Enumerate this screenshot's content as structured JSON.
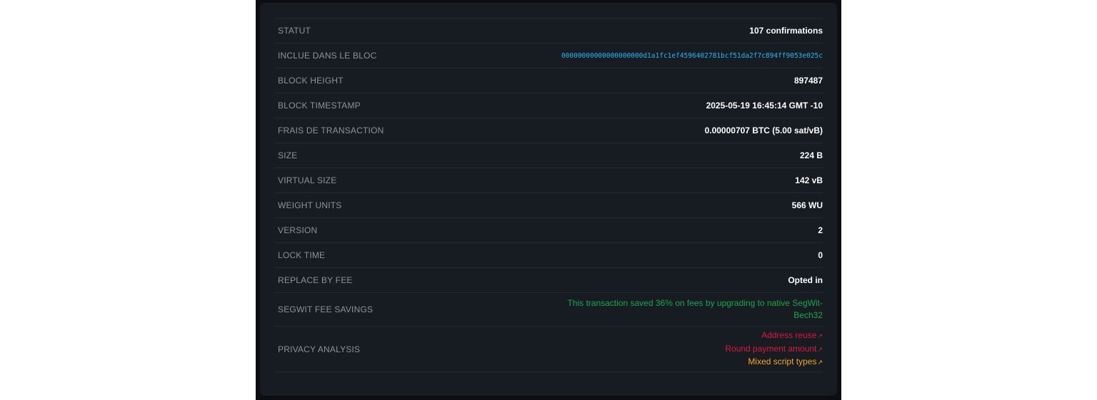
{
  "rows": [
    {
      "label": "STATUT",
      "value": "107 confirmations"
    },
    {
      "label": "INCLUE DANS LE BLOC",
      "value": "00000000000000000000d1a1fc1ef4596402781bcf51da2f7c894ff9053e025c"
    },
    {
      "label": "BLOCK HEIGHT",
      "value": "897487"
    },
    {
      "label": "BLOCK TIMESTAMP",
      "value": "2025-05-19 16:45:14 GMT -10"
    },
    {
      "label": "FRAIS DE TRANSACTION",
      "value": "0.00000707 BTC (5.00 sat/vB)"
    },
    {
      "label": "SIZE",
      "value": "224 B"
    },
    {
      "label": "VIRTUAL SIZE",
      "value": "142 vB"
    },
    {
      "label": "WEIGHT UNITS",
      "value": "566 WU"
    },
    {
      "label": "VERSION",
      "value": "2"
    },
    {
      "label": "LOCK TIME",
      "value": "0"
    },
    {
      "label": "REPLACE BY FEE",
      "value": "Opted in"
    },
    {
      "label": "SEGWIT FEE SAVINGS",
      "value": "This transaction saved 36% on fees by upgrading to native SegWit-Bech32"
    },
    {
      "label": "PRIVACY ANALYSIS"
    }
  ],
  "privacy": {
    "items": [
      {
        "label": "Address reuse",
        "color": "#e0173b"
      },
      {
        "label": "Round payment amount",
        "color": "#e0173b"
      },
      {
        "label": "Mixed script types",
        "color": "#f5a623"
      }
    ],
    "arrow_icon": "external-link-arrow-icon"
  },
  "colors": {
    "hash_link": "#29b6f6",
    "segwit_savings": "#1fa64a",
    "warning_red": "#e0173b",
    "warning_orange": "#f5a623"
  }
}
